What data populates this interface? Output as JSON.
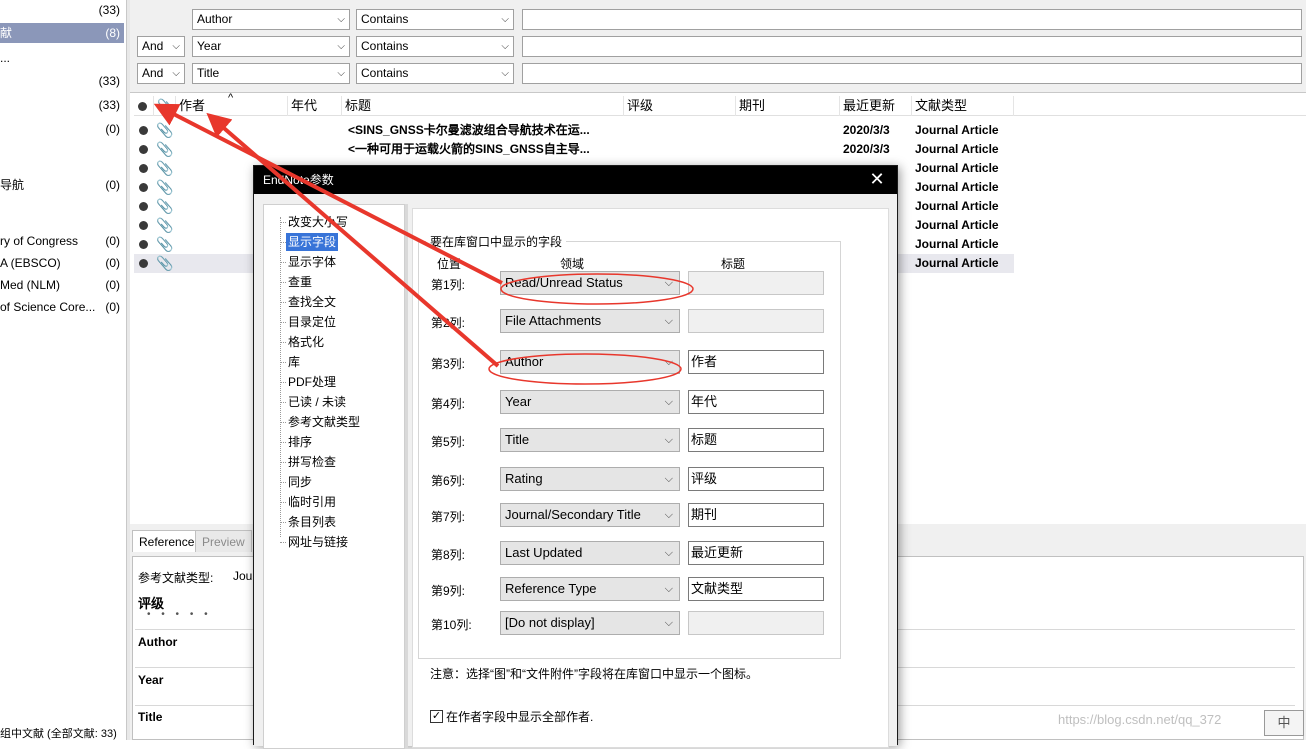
{
  "left_panel": {
    "groups": [
      {
        "name": "",
        "count": "(33)",
        "selected": false
      },
      {
        "name": "献",
        "count": "(8)",
        "selected": true
      },
      {
        "name": "...",
        "count": "",
        "selected": false
      },
      {
        "name": "",
        "count": "(33)",
        "selected": false
      },
      {
        "name": "",
        "count": "(33)",
        "selected": false
      },
      {
        "name": "",
        "count": "(0)",
        "selected": false
      },
      {
        "name": "导航",
        "count": "(0)",
        "selected": false
      },
      {
        "name": "ry of Congress",
        "count": "(0)",
        "selected": false
      },
      {
        "name": "A (EBSCO)",
        "count": "(0)",
        "selected": false
      },
      {
        "name": "Med (NLM)",
        "count": "(0)",
        "selected": false
      },
      {
        "name": "of Science Core...",
        "count": "(0)",
        "selected": false
      }
    ]
  },
  "search": {
    "rows": [
      {
        "bool": "",
        "field": "Author",
        "op": "Contains"
      },
      {
        "bool": "And",
        "field": "Year",
        "op": "Contains"
      },
      {
        "bool": "And",
        "field": "Title",
        "op": "Contains"
      }
    ]
  },
  "list": {
    "sort_indicator": "^",
    "columns": [
      "作者",
      "年代",
      "标题",
      "评级",
      "期刊",
      "最近更新",
      "文献类型"
    ],
    "rows": [
      {
        "title": "<SINS_GNSS卡尔曼滤波组合导航技术在运...",
        "updated": "2020/3/3",
        "type": "Journal Article"
      },
      {
        "title": "<一种可用于运载火箭的SINS_GNSS自主导...",
        "updated": "2020/3/3",
        "type": "Journal Article"
      },
      {
        "title": "",
        "updated": "",
        "type": "Journal Article"
      },
      {
        "title": "",
        "updated": "",
        "type": "Journal Article"
      },
      {
        "title": "",
        "updated": "",
        "type": "Journal Article"
      },
      {
        "title": "",
        "updated": "",
        "type": "Journal Article"
      },
      {
        "title": "",
        "updated": "",
        "type": "Journal Article"
      },
      {
        "title": "",
        "updated": "",
        "type": "Journal Article"
      }
    ]
  },
  "bottom": {
    "tabs": [
      "Reference",
      "Preview"
    ],
    "ref_type_label": "参考文献类型:",
    "ref_type_value": "Jou",
    "rating_label": "评级",
    "rating_dots": "• • • • •",
    "author_label": "Author",
    "year_label": "Year",
    "title_label": "Title"
  },
  "status_bar": {
    "text": "组中文献 (全部文献: 33)"
  },
  "dialog": {
    "title": "EndNote参数",
    "close": "✕",
    "tree": [
      "改变大小写",
      "显示字段",
      "显示字体",
      "查重",
      "查找全文",
      "目录定位",
      "格式化",
      "库",
      "PDF处理",
      "已读 / 未读",
      "参考文献类型",
      "排序",
      "拼写检查",
      "同步",
      "临时引用",
      "条目列表",
      "网址与链接"
    ],
    "selected_tree_index": 1,
    "group_title": "要在库窗口中显示的字段",
    "col_position": "位置",
    "col_field": "领域",
    "col_label": "标题",
    "fields": [
      {
        "pos": "第1列:",
        "field": "Read/Unread Status",
        "label": ""
      },
      {
        "pos": "第2列:",
        "field": "File Attachments",
        "label": ""
      },
      {
        "pos": "第3列:",
        "field": "Author",
        "label": "作者"
      },
      {
        "pos": "第4列:",
        "field": "Year",
        "label": "年代"
      },
      {
        "pos": "第5列:",
        "field": "Title",
        "label": "标题"
      },
      {
        "pos": "第6列:",
        "field": "Rating",
        "label": "评级"
      },
      {
        "pos": "第7列:",
        "field": "Journal/Secondary Title",
        "label": "期刊"
      },
      {
        "pos": "第8列:",
        "field": "Last Updated",
        "label": "最近更新"
      },
      {
        "pos": "第9列:",
        "field": "Reference Type",
        "label": "文献类型"
      },
      {
        "pos": "第10列:",
        "field": "[Do not display]",
        "label": ""
      }
    ],
    "note": "注意：选择“图”和“文件附件”字段将在库窗口中显示一个图标。",
    "checkbox_checked": "✓",
    "checkbox_label": "在作者字段中显示全部作者."
  },
  "annotation": {
    "color": "#e8372c"
  },
  "watermark": "https://blog.csdn.net/qq_372",
  "ime": "中"
}
